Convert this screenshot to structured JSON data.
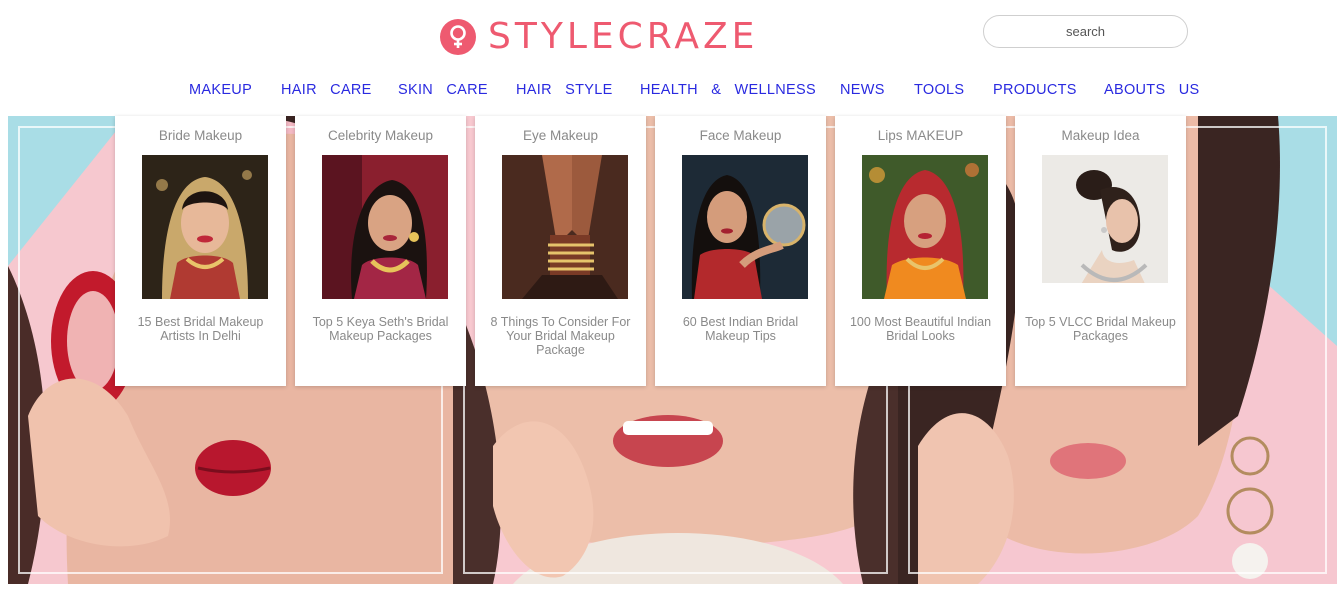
{
  "brand": {
    "name": "STYLECRAZE",
    "color": "#ee5a70"
  },
  "search": {
    "placeholder": "search"
  },
  "nav": {
    "items": [
      {
        "label": "MAKEUP"
      },
      {
        "label": "HAIR CARE"
      },
      {
        "label": "SKIN CARE"
      },
      {
        "label": "HAIR STYLE"
      },
      {
        "label": "HEALTH & WELLNESS"
      },
      {
        "label": "NEWS"
      },
      {
        "label": "TOOLS"
      },
      {
        "label": "PRODUCTS"
      },
      {
        "label": "ABOUTS US"
      }
    ],
    "color": "#2a2ae0"
  },
  "dropdown": {
    "cards": [
      {
        "category": "Bride Makeup",
        "title": "15 Best Bridal Makeup Artists In Delhi",
        "image": "bride-portrait-image"
      },
      {
        "category": "Celebrity Makeup",
        "title": "Top 5 Keya Seth's Bridal Makeup Packages",
        "image": "celebrity-bride-image"
      },
      {
        "category": "Eye Makeup",
        "title": "8 Things To Consider For Your Bridal Makeup Package",
        "image": "henna-hands-image"
      },
      {
        "category": "Face Makeup",
        "title": "60 Best Indian Bridal Makeup Tips",
        "image": "bride-mirror-image"
      },
      {
        "category": "Lips MAKEUP",
        "title": "100 Most Beautiful Indian Bridal Looks",
        "image": "bride-veil-image"
      },
      {
        "category": "Makeup Idea",
        "title": "Top 5 VLCC Bridal Makeup Packages",
        "image": "bride-updo-image"
      }
    ]
  },
  "hero": {
    "panels": [
      {
        "image": "woman-red-lips-image"
      },
      {
        "image": "woman-smiling-image"
      },
      {
        "image": "woman-earring-image"
      }
    ]
  }
}
